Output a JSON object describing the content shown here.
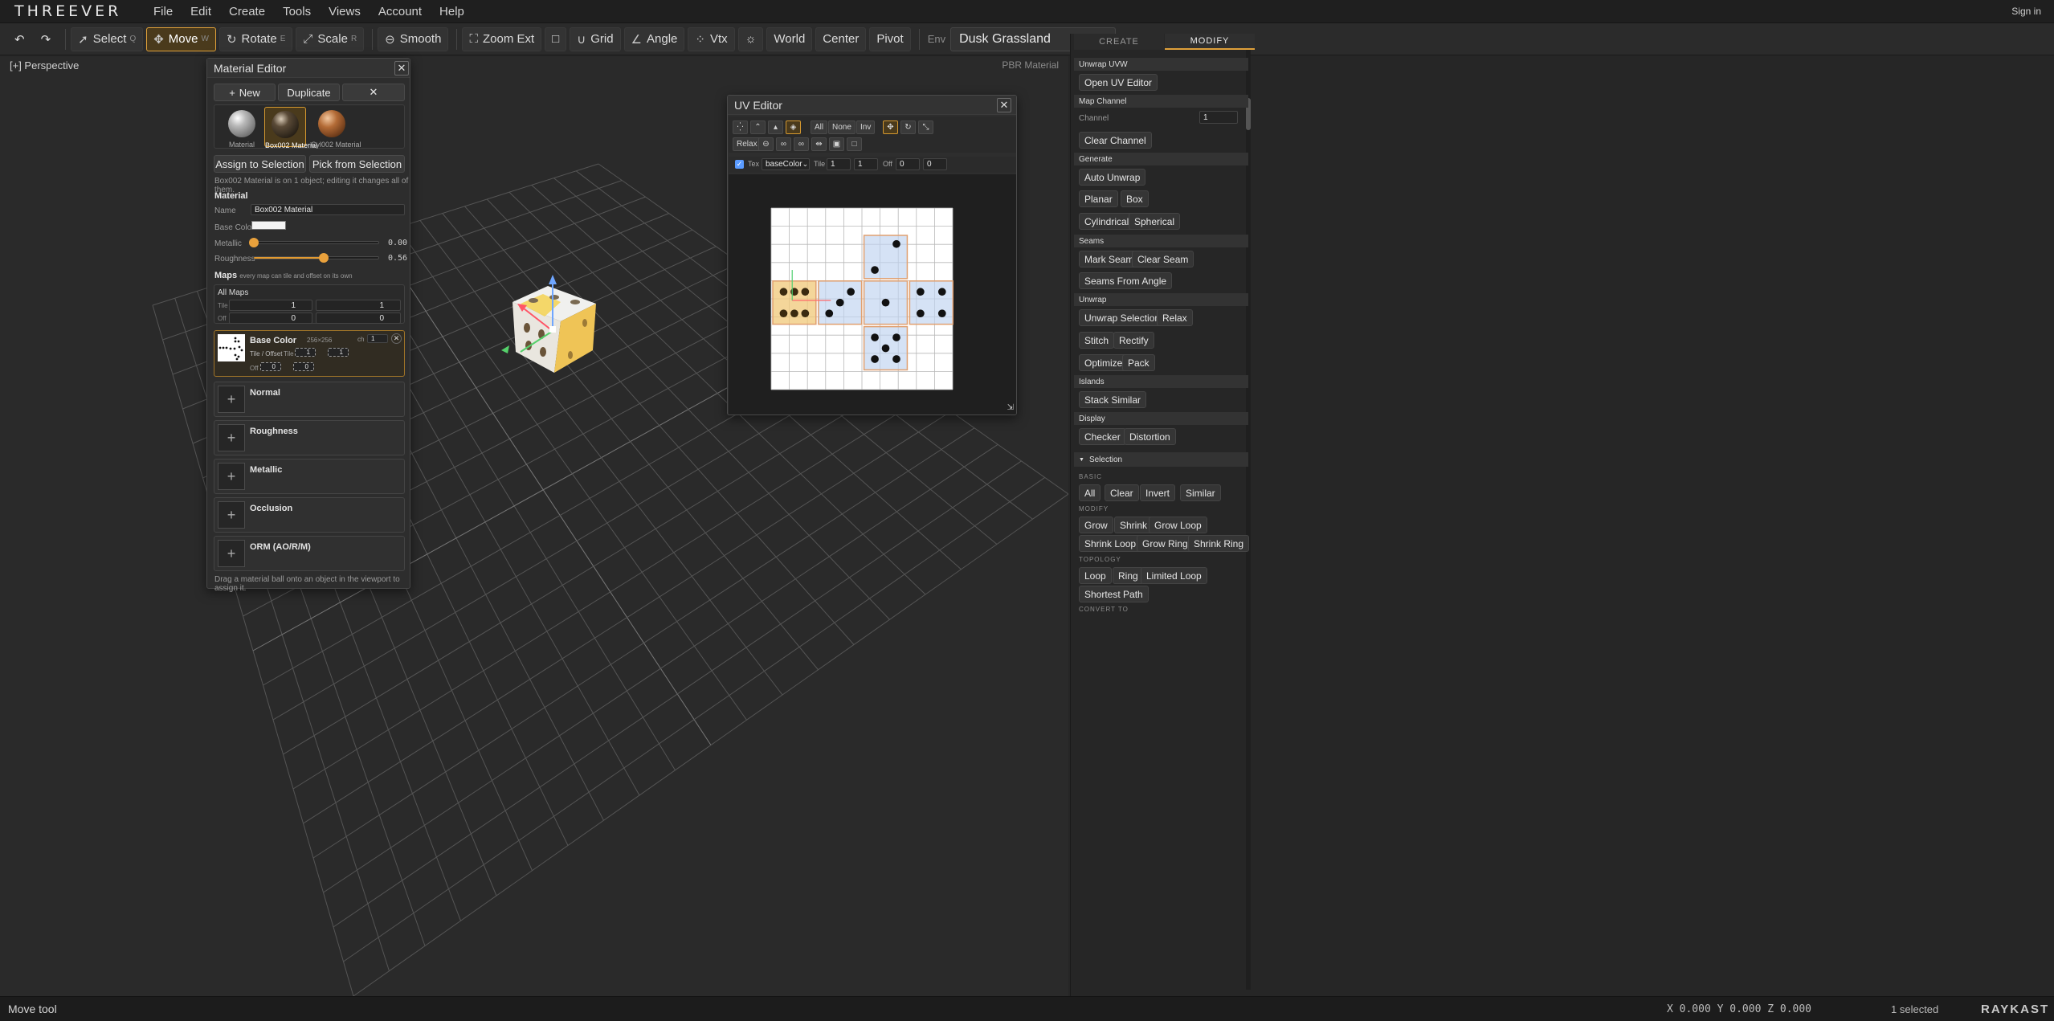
{
  "app": {
    "logo": "THREEVER",
    "signin": "Sign in"
  },
  "menu": [
    "File",
    "Edit",
    "Create",
    "Tools",
    "Views",
    "Account",
    "Help"
  ],
  "toolbar": {
    "select": "Select",
    "select_key": "Q",
    "move": "Move",
    "move_key": "W",
    "rotate": "Rotate",
    "rotate_key": "E",
    "scale": "Scale",
    "scale_key": "R",
    "smooth": "Smooth",
    "zoom_ext": "Zoom Ext",
    "grid": "Grid",
    "angle": "Angle",
    "vtx": "Vtx",
    "world": "World",
    "center": "Center",
    "pivot": "Pivot",
    "env_label": "Env",
    "env_value": "Dusk Grassland"
  },
  "viewport": {
    "label": "[+] Perspective",
    "mode": "PBR Material"
  },
  "material_editor": {
    "title": "Material Editor",
    "new": "New",
    "duplicate": "Duplicate",
    "materials": [
      {
        "label": "Material",
        "color": "#9a9a9a"
      },
      {
        "label": "Box002 Material",
        "color": "#3a2f22"
      },
      {
        "label": "Cyl002 Material",
        "color": "#b06a35"
      }
    ],
    "assign": "Assign to Selection",
    "pick": "Pick from Selection",
    "note": "Box002 Material is on 1 object; editing it changes all of them.",
    "section_material": "Material",
    "name_label": "Name",
    "name_value": "Box002 Material",
    "base_color_label": "Base Color",
    "base_color": "#f4f4f4",
    "metallic_label": "Metallic",
    "metallic_value": "0.00",
    "metallic": 0.0,
    "roughness_label": "Roughness",
    "roughness_value": "0.56",
    "roughness": 0.56,
    "maps_label": "Maps",
    "maps_hint": "every map can tile and offset on its own",
    "all_maps": "All Maps",
    "tile_label": "Tile",
    "off_label": "Off",
    "tile_u": "1",
    "tile_v": "1",
    "off_u": "0",
    "off_v": "0",
    "base_map": {
      "name": "Base Color",
      "size": "256×256",
      "ch_label": "ch",
      "ch_value": "1",
      "tile_offset": "Tile / Offset",
      "tile_label": "Tile",
      "tile_u": "1",
      "tile_v": "1",
      "off_label": "Off",
      "off_u": "0",
      "off_v": "0"
    },
    "maps": [
      "Normal",
      "Roughness",
      "Metallic",
      "Occlusion",
      "ORM (AO/R/M)"
    ],
    "footer": "Drag a material ball onto an object in the viewport to assign it."
  },
  "uv_editor": {
    "title": "UV Editor",
    "all": "All",
    "none": "None",
    "inv": "Inv",
    "relax": "Relax",
    "tex_label": "Tex",
    "tex_value": "baseColor",
    "tile_label": "Tile",
    "tile_u": "1",
    "tile_v": "1",
    "off_label": "Off",
    "off_u": "0",
    "off_v": "0"
  },
  "right_panel": {
    "tab_create": "CREATE",
    "tab_modify": "MODIFY",
    "unwrap_uvw": "Unwrap UVW",
    "open_uv_editor": "Open UV Editor",
    "map_channel": "Map Channel",
    "channel_label": "Channel",
    "channel_value": "1",
    "clear_channel": "Clear Channel",
    "generate": "Generate",
    "auto_unwrap": "Auto Unwrap",
    "planar": "Planar",
    "box": "Box",
    "cylindrical": "Cylindrical",
    "spherical": "Spherical",
    "seams": "Seams",
    "mark_seam": "Mark Seam",
    "clear_seam": "Clear Seam",
    "seams_from_angle": "Seams From Angle",
    "unwrap": "Unwrap",
    "unwrap_selection": "Unwrap Selection",
    "relax": "Relax",
    "stitch": "Stitch",
    "rectify": "Rectify",
    "optimize": "Optimize",
    "pack": "Pack",
    "islands": "Islands",
    "stack_similar": "Stack Similar",
    "display": "Display",
    "checker": "Checker",
    "distortion": "Distortion",
    "selection": "Selection",
    "basic": "BASIC",
    "all": "All",
    "clear": "Clear",
    "invert": "Invert",
    "similar": "Similar",
    "modify": "MODIFY",
    "grow": "Grow",
    "shrink": "Shrink",
    "grow_loop": "Grow Loop",
    "shrink_loop": "Shrink Loop",
    "grow_ring": "Grow Ring",
    "shrink_ring": "Shrink Ring",
    "topology": "TOPOLOGY",
    "loop": "Loop",
    "ring": "Ring",
    "limited_loop": "Limited Loop",
    "shortest_path": "Shortest Path",
    "convert_to": "CONVERT TO"
  },
  "status": {
    "tool": "Move tool",
    "coords": "X 0.000  Y 0.000  Z 0.000",
    "selected": "1 selected",
    "brand": "RAYKAST"
  },
  "colors": {
    "accent": "#e0a13a",
    "panel": "#2d2d2d",
    "viewport_bg": "#2a2a2a"
  }
}
